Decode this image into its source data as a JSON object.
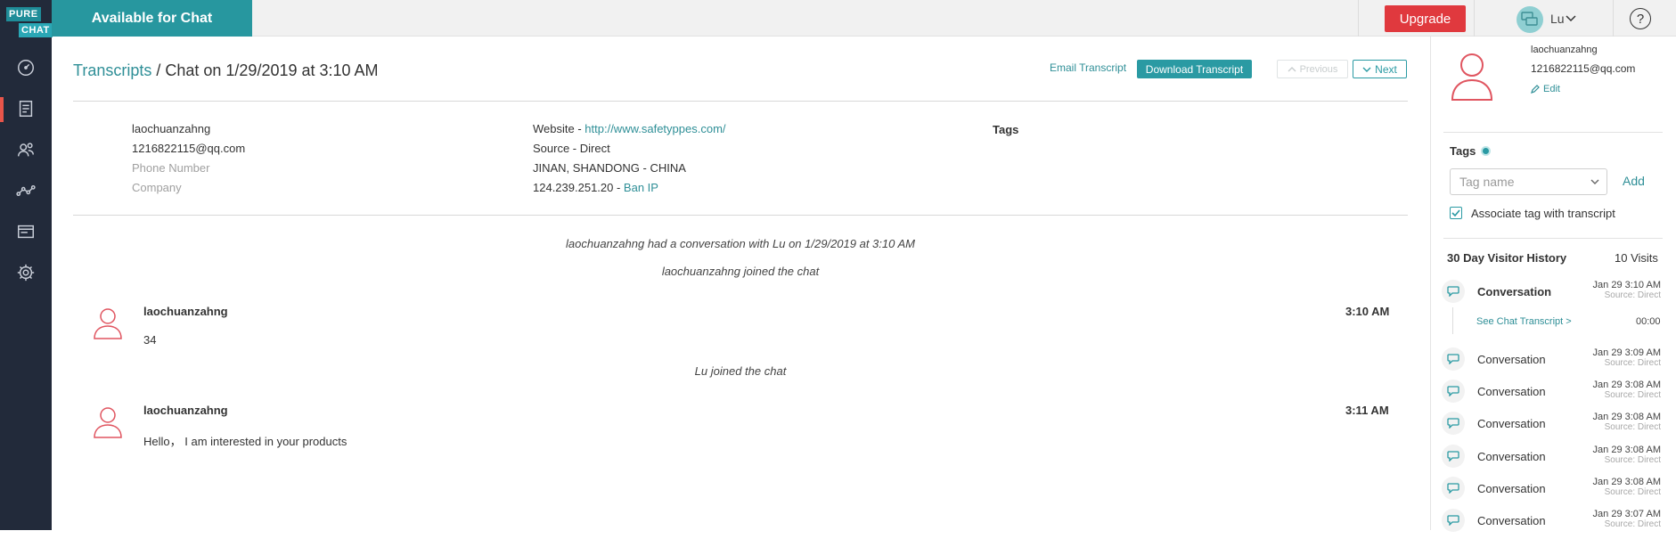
{
  "logo": {
    "line1": "PURE",
    "line2": "CHAT"
  },
  "rail": [
    "dashboard-icon",
    "transcripts-icon",
    "contacts-icon",
    "analytics-icon",
    "widgets-icon",
    "settings-icon"
  ],
  "topbar": {
    "status": "Available for Chat",
    "upgrade": "Upgrade",
    "user": "Lu",
    "help": "?"
  },
  "header": {
    "breadcrumb_link": "Transcripts",
    "breadcrumb_rest": " / Chat on 1/29/2019 at 3:10 AM",
    "email_transcript": "Email Transcript",
    "download_transcript": "Download Transcript",
    "previous": "Previous",
    "next": "Next"
  },
  "visitor": {
    "name": "laochuanzahng",
    "email": "1216822115@qq.com",
    "phone_placeholder": "Phone Number",
    "company_placeholder": "Company"
  },
  "details": {
    "website_label": "Website - ",
    "website_url": "http://www.safetyppes.com/",
    "source": "Source - Direct",
    "location": "JINAN, SHANDONG - CHINA",
    "ip": "124.239.251.20 - ",
    "ban_ip": "Ban IP"
  },
  "tags_heading": "Tags",
  "transcript": {
    "intro": "laochuanzahng had a conversation with Lu on 1/29/2019 at 3:10 AM",
    "joined1": "laochuanzahng joined the chat",
    "joined2": "Lu joined the chat",
    "messages": [
      {
        "name": "laochuanzahng",
        "text": "34",
        "time": "3:10 AM"
      },
      {
        "name": "laochuanzahng",
        "text": "Hello， I am interested in your products",
        "time": "3:11 AM"
      }
    ]
  },
  "panel": {
    "name": "laochuanzahng",
    "email": "1216822115@qq.com",
    "edit": "Edit",
    "tags": "Tags",
    "tag_placeholder": "Tag name",
    "add": "Add",
    "associate": "Associate tag with transcript",
    "history_title": "30 Day Visitor History",
    "visits": "10 Visits",
    "see_transcript": "See Chat Transcript >",
    "duration": "00:00",
    "history": [
      {
        "label": "Conversation",
        "date": "Jan 29 3:10 AM",
        "source": "Source: Direct"
      },
      {
        "label": "Conversation",
        "date": "Jan 29 3:09 AM",
        "source": "Source: Direct"
      },
      {
        "label": "Conversation",
        "date": "Jan 29 3:08 AM",
        "source": "Source: Direct"
      },
      {
        "label": "Conversation",
        "date": "Jan 29 3:08 AM",
        "source": "Source: Direct"
      },
      {
        "label": "Conversation",
        "date": "Jan 29 3:08 AM",
        "source": "Source: Direct"
      },
      {
        "label": "Conversation",
        "date": "Jan 29 3:08 AM",
        "source": "Source: Direct"
      },
      {
        "label": "Conversation",
        "date": "Jan 29 3:07 AM",
        "source": "Source: Direct"
      }
    ]
  },
  "colors": {
    "accent": "#2a9aa3",
    "rail": "#222a3a",
    "upgrade": "#e0393e",
    "avatar": "#e05560"
  }
}
